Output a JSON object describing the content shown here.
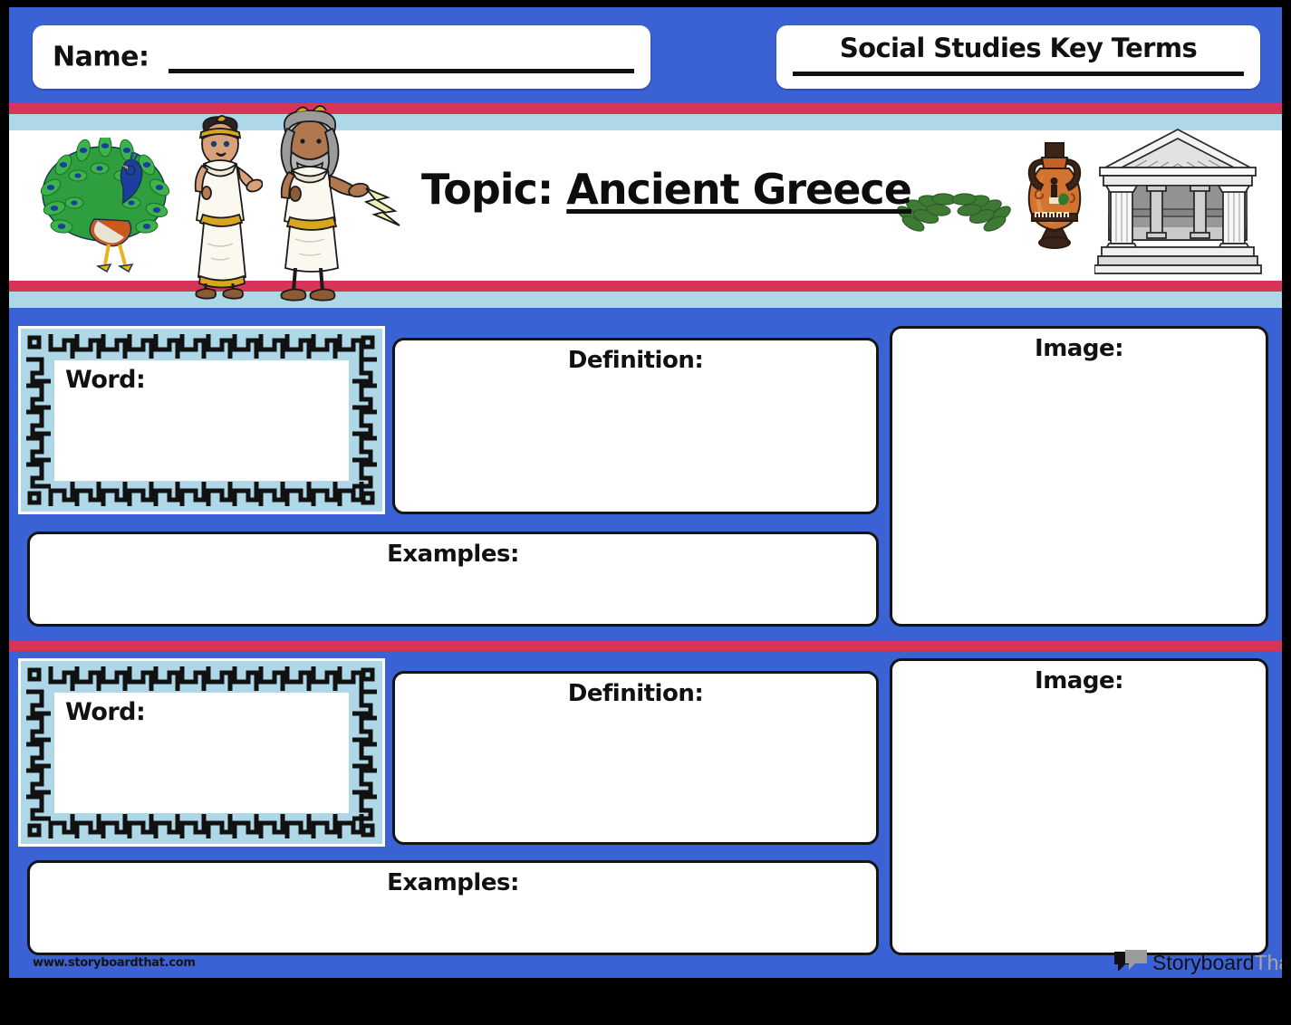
{
  "worksheet": {
    "header": {
      "name_label": "Name:",
      "title": "Social Studies Key Terms"
    },
    "banner": {
      "topic_label": "Topic:",
      "topic_value": "Ancient Greece",
      "illustrations": [
        "peacock-icon",
        "greek-woman-hera-icon",
        "greek-god-zeus-lightning-icon",
        "laurel-wreath-icon",
        "greek-amphora-vase-icon",
        "greek-temple-icon"
      ]
    },
    "entries": [
      {
        "word_label": "Word:",
        "word_value": "",
        "definition_label": "Definition:",
        "definition_value": "",
        "examples_label": "Examples:",
        "examples_value": "",
        "image_label": "Image:",
        "image_value": ""
      },
      {
        "word_label": "Word:",
        "word_value": "",
        "definition_label": "Definition:",
        "definition_value": "",
        "examples_label": "Examples:",
        "examples_value": "",
        "image_label": "Image:",
        "image_value": ""
      }
    ],
    "footer": {
      "url": "www.storyboardthat.com",
      "logo_primary": "Storyboard",
      "logo_secondary": "That"
    },
    "colors": {
      "background_blue": "#3a62d4",
      "stripe_crimson": "#d63459",
      "stripe_light_blue": "#aed8e8",
      "box_white": "#ffffff",
      "ink_black": "#141414",
      "logo_grey": "#a8a8a8"
    }
  }
}
